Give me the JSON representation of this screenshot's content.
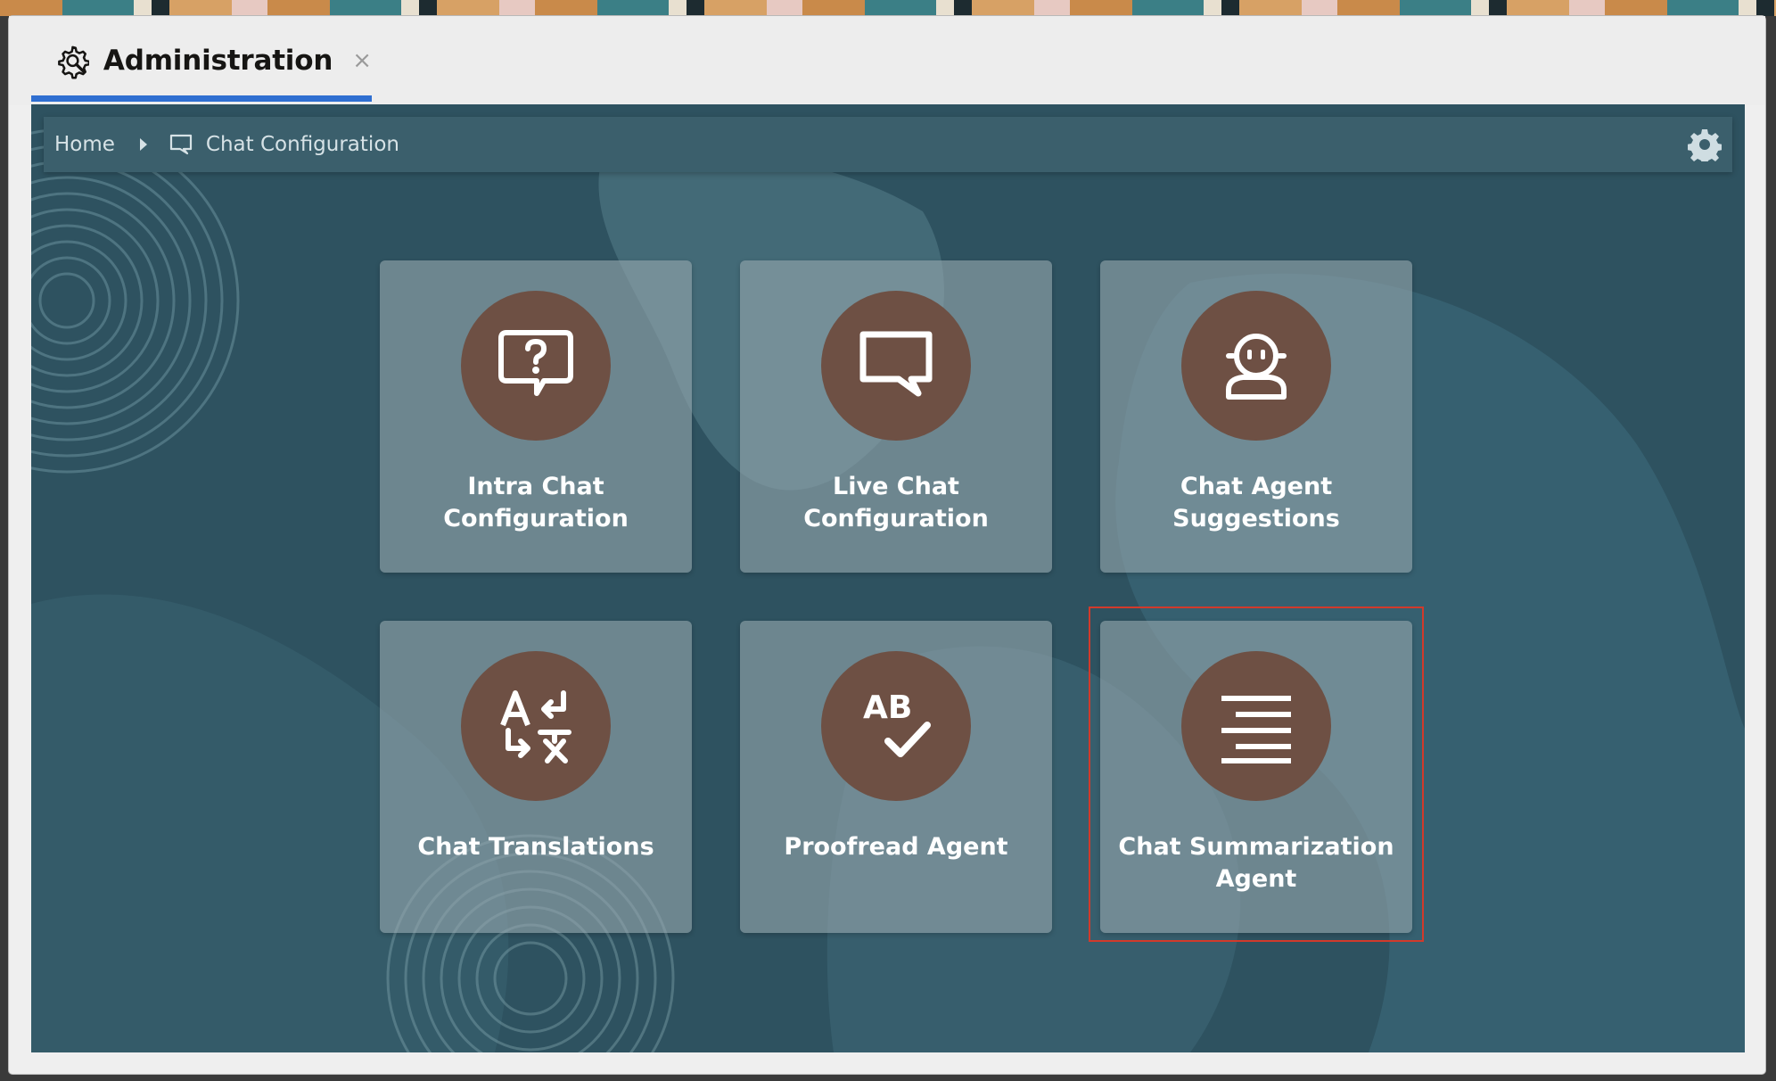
{
  "window": {
    "tab_title": "Administration",
    "tab_close": "×",
    "tab_icon": "gear-wrench-icon",
    "active_tab_color": "#2f6fd1"
  },
  "breadcrumb": {
    "home": "Home",
    "current": "Chat Configuration",
    "current_icon": "chat-bubble-icon",
    "settings_icon": "gear-icon"
  },
  "tiles": [
    {
      "label_line1": "Intra Chat",
      "label_line2": "Configuration",
      "icon": "chat-question-icon"
    },
    {
      "label_line1": "Live Chat",
      "label_line2": "Configuration",
      "icon": "chat-bubble-icon"
    },
    {
      "label_line1": "Chat Agent",
      "label_line2": "Suggestions",
      "icon": "chat-agent-icon"
    },
    {
      "label_line1": "Chat Translations",
      "label_line2": "",
      "icon": "translate-icon"
    },
    {
      "label_line1": "Proofread Agent",
      "label_line2": "",
      "icon": "proofread-icon",
      "icon_text": "AB"
    },
    {
      "label_line1": "Chat Summarization",
      "label_line2": "Agent",
      "icon": "summary-lines-icon"
    }
  ],
  "colors": {
    "content_bg": "#2f5563",
    "tile_icon_circle": "#6e5044",
    "highlight": "#d23a2b"
  }
}
